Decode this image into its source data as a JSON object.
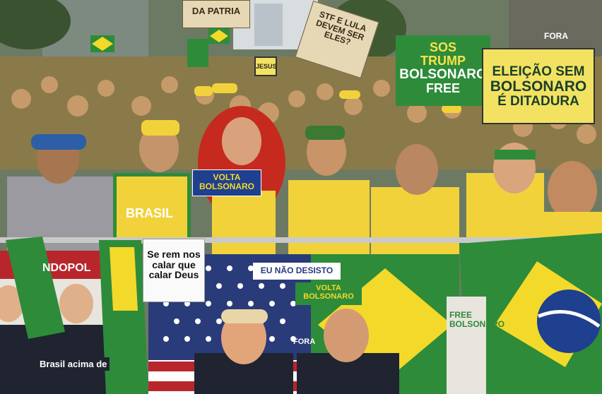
{
  "signs": {
    "sos_trump_line1": "SOS",
    "sos_trump_line2": "TRUMP",
    "sos_trump_line3": "BOLSONARO",
    "sos_trump_line4": "FREE",
    "eleicao_line1": "ELEIÇÃO SEM",
    "eleicao_line2": "BOLSONARO",
    "eleicao_line3": "É DITADURA",
    "patria": "DA PATRIA",
    "stf_lula": "STF E LULA DEVEM SER ELES?",
    "jesus": "JESUS",
    "volta_bolsonaro": "VOLTA BOLSONARO",
    "calar_deus": "Se rem nos calar que calar Deus",
    "eu_nao_desisto": "EU NÃO DESISTO",
    "volta_bolsonaro_banner": "VOLTA BOLSONARO",
    "brasil_acima": "Brasil acima de",
    "dopol": "NDOPOL",
    "shirt_brasil": "BRASIL",
    "fora": "FORA",
    "free_bolsonaro": "FREE BOLSONARO",
    "fora2": "FORA"
  },
  "colors": {
    "brazil_green": "#2e8b3a",
    "brazil_yellow": "#f3d92a",
    "brazil_blue": "#1f3f8f",
    "us_red": "#b8262c",
    "us_blue": "#2a3b7a"
  }
}
